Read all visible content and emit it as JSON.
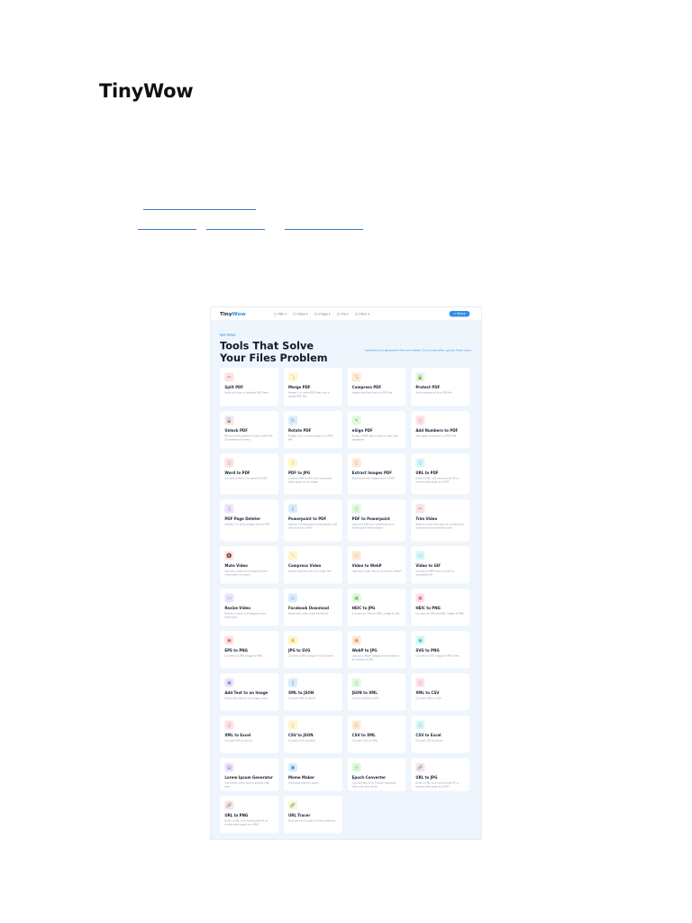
{
  "document": {
    "title": "TinyWow"
  },
  "app": {
    "logo_a": "Tiny",
    "logo_b": "Wow",
    "nav": [
      "PDF ▾",
      "Video ▾",
      "Image ▾",
      "File ▾",
      "Other ▾"
    ],
    "share_label": "< Share",
    "eyebrow": "OUR TOOLS",
    "heading": "Tools That Solve Your Files Problem",
    "note": "Uploaded and generated files are deleted 15 minutes after upload. Read more",
    "palette": [
      "#fde3e3",
      "#fdf6d0",
      "#fde9d6",
      "#d7f6f7",
      "#ebe5fb",
      "#dcebfc",
      "#e1f7dc",
      "#fce2ea"
    ],
    "icon_colors": [
      "#e05555",
      "#e0c030",
      "#e58a3a",
      "#2fbcc4",
      "#8a6ae0",
      "#3a8ae0",
      "#59c04a",
      "#e0557a"
    ],
    "tools": [
      {
        "t": "Split PDF",
        "d": "Split into one or multiple PDF files",
        "i": "✂"
      },
      {
        "t": "Merge PDF",
        "d": "Merge 2 or more PDF files into a single PDF file",
        "i": "⤵"
      },
      {
        "t": "Compress PDF",
        "d": "Lessen the file size of a PDF file",
        "i": "⤡"
      },
      {
        "t": "Protect PDF",
        "d": "Add a password to a PDF file",
        "i": "🔒"
      },
      {
        "t": "Unlock PDF",
        "d": "Remove the password from a PDF file (if password known)",
        "i": "🔓"
      },
      {
        "t": "Rotate PDF",
        "d": "Rotate one or more pages in a PDF file",
        "i": "↻"
      },
      {
        "t": "eSign PDF",
        "d": "E-sign a PDF with a font or with your signature",
        "i": "✎"
      },
      {
        "t": "Add Numbers to PDF",
        "d": "Add page numbers to a PDF file",
        "i": "▯"
      },
      {
        "t": "Word to PDF",
        "d": "Convert a Word Document to PDF",
        "i": "▯"
      },
      {
        "t": "PDF to JPG",
        "d": "Convert PDF to JPG and download each page as an image",
        "i": "▯"
      },
      {
        "t": "Extract Images PDF",
        "d": "Download the images from a PDF",
        "i": "▯"
      },
      {
        "t": "URL to PDF",
        "d": "Enter a URL and receive the PC or mobile web page as a PDF",
        "i": "▯"
      },
      {
        "t": "PDF Page Deleter",
        "d": "Delete 1 or more pages from a PDF",
        "i": "▯"
      },
      {
        "t": "Powerpoint to PDF",
        "d": "Upload a Powerpoint presentation and download as a PDF",
        "i": "▯"
      },
      {
        "t": "PDF to Powerpoint",
        "d": "Upload a PDF and download as a Powerpoint Presentation",
        "i": "▯"
      },
      {
        "t": "Trim Video",
        "d": "Select a start and stop of a video and download the trimmed video",
        "i": "✂"
      },
      {
        "t": "Mute Video",
        "d": "Upload a video and download the video with no sound",
        "i": "🔇"
      },
      {
        "t": "Compress Video",
        "d": "Lessen the file size of a Video file",
        "i": "⤡"
      },
      {
        "t": "Video to WebP",
        "d": "Upload a video file to convert to WebP",
        "i": "▭"
      },
      {
        "t": "Video to GIF",
        "d": "Upload an MP4 and convert to animated GIF",
        "i": "▭"
      },
      {
        "t": "Resize Video",
        "d": "Resize a video to Instagram and download",
        "i": "▭"
      },
      {
        "t": "Facebook Download",
        "d": "Download video from Facebook",
        "i": "▭"
      },
      {
        "t": "HEIC to JPG",
        "d": "Convert an iPhone HEIC image to JPG",
        "i": "▣"
      },
      {
        "t": "HEIC to PNG",
        "d": "Convert an iPhone HEIC image to PNG",
        "i": "▣"
      },
      {
        "t": "EPS to PNG",
        "d": "Convert an EPS image to PNG",
        "i": "▣"
      },
      {
        "t": "JPG to SVG",
        "d": "Convert a JPG image to SVG Online",
        "i": "▣"
      },
      {
        "t": "WebP to JPG",
        "d": "Upload a WebP image and download all frames as JPG",
        "i": "▣"
      },
      {
        "t": "SVG to PNG",
        "d": "Convert a SVG image to PNG Free",
        "i": "▣"
      },
      {
        "t": "Add Text to an Image",
        "d": "Easily add text to an image online",
        "i": "▣"
      },
      {
        "t": "XML to JSON",
        "d": "Convert XML to JSON",
        "i": "▯"
      },
      {
        "t": "JSON to XML",
        "d": "Convert JSON to XML",
        "i": "▯"
      },
      {
        "t": "XML to CSV",
        "d": "Convert XML to CSV",
        "i": "▯"
      },
      {
        "t": "XML to Excel",
        "d": "Convert XML to Excel",
        "i": "▯"
      },
      {
        "t": "CSV to JSON",
        "d": "Convert CSV to JSON",
        "i": "▯"
      },
      {
        "t": "CSV to XML",
        "d": "Convert CSV to XML",
        "i": "▯"
      },
      {
        "t": "CSV to Excel",
        "d": "Convert CSV to Excel",
        "i": "▯"
      },
      {
        "t": "Lorem Ipsum Generator",
        "d": "Generate Lorem Ipsum placeholder text",
        "i": "▤"
      },
      {
        "t": "Meme Maker",
        "d": "Generate memes easily",
        "i": "▣"
      },
      {
        "t": "Epoch Converter",
        "d": "Convert epoch to human-readable date and vice versa",
        "i": "◷"
      },
      {
        "t": "URL to JPG",
        "d": "Enter a URL and receive the PC or mobile web page as a JPG",
        "i": "🔗"
      },
      {
        "t": "URL to PNG",
        "d": "Enter a URL and receive the PC or mobile web page as a PNG",
        "i": "🔗"
      },
      {
        "t": "URL Tracer",
        "d": "Find the end location of the redirects",
        "i": "🔗"
      }
    ]
  }
}
